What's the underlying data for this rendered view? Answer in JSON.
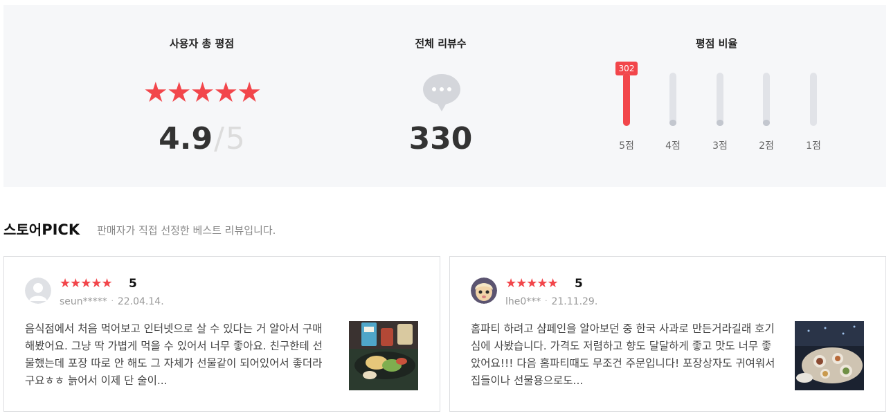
{
  "summary": {
    "rating_title": "사용자 총 평점",
    "rating_stars": "★★★★★",
    "rating_value": "4.9",
    "rating_separator": "/",
    "rating_max": "5",
    "count_title": "전체 리뷰수",
    "count_value": "330",
    "ratio_title": "평점 비율",
    "ratio": [
      {
        "label": "5점",
        "count": "302",
        "fraction": 1.0
      },
      {
        "label": "4점",
        "fraction": 0.12
      },
      {
        "label": "3점",
        "fraction": 0.12
      },
      {
        "label": "2점",
        "fraction": 0.12
      },
      {
        "label": "1점",
        "fraction": 0.0
      }
    ]
  },
  "pick": {
    "title_prefix": "스토어",
    "title_strong": "PICK",
    "description": "판매자가 직접 선정한 베스트 리뷰입니다."
  },
  "reviews": [
    {
      "stars": "★★★★★",
      "score": "5",
      "user": "seun*****",
      "date": "22.04.14.",
      "text": "음식점에서 처음 먹어보고 인터넷으로 살 수 있다는 거 알아서 구매해봤어요. 그냥 딱 가볍게 먹을 수 있어서 너무 좋아요. 친구한테 선물했는데 포장 따로 안 해도 그 자체가 선물같이 되어있어서 좋더라구요ㅎㅎ 늙어서 이제 단 술이..."
    },
    {
      "stars": "★★★★★",
      "score": "5",
      "user": "lhe0***",
      "date": "21.11.29.",
      "text": "홈파티 하려고 샴페인을 알아보던 중 한국 사과로 만든거라길래 호기심에 사봤습니다. 가격도 저렴하고 향도 달달하게 좋고 맛도 너무 좋았어요!!! 다음 홈파티때도 무조건 주문입니다! 포장상자도 귀여워서 집들이나 선물용으로도..."
    }
  ],
  "colors": {
    "accent": "#f2464b",
    "panel": "#f6f7f9",
    "track": "#e1e3e8"
  }
}
